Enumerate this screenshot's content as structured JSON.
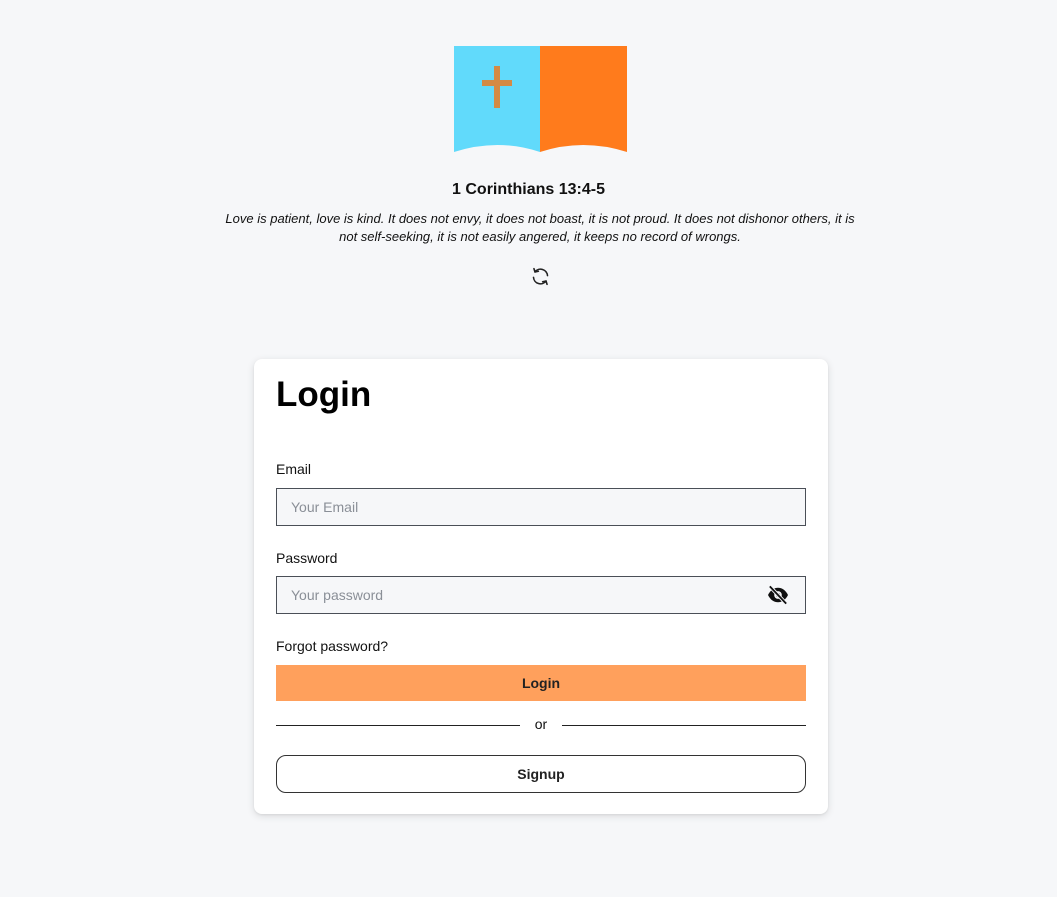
{
  "logo": {
    "icon": "open-bible-cross-icon",
    "colors": {
      "left_page": "#61dafb",
      "right_page": "#ff7b1c",
      "cross": "#d48a44"
    }
  },
  "verse": {
    "reference": "1 Corinthians 13:4-5",
    "text": "Love is patient, love is kind. It does not envy, it does not boast, it is not proud. It does not dishonor others, it is not self-seeking, it is not easily angered, it keeps no record of wrongs.",
    "refresh_icon": "refresh-icon"
  },
  "login": {
    "title": "Login",
    "email": {
      "label": "Email",
      "placeholder": "Your Email",
      "value": ""
    },
    "password": {
      "label": "Password",
      "placeholder": "Your password",
      "value": "",
      "toggle_icon": "eye-off-icon"
    },
    "forgot_label": "Forgot password?",
    "login_label": "Login",
    "divider_label": "or",
    "signup_label": "Signup",
    "colors": {
      "login_button": "#ffa05c"
    }
  }
}
